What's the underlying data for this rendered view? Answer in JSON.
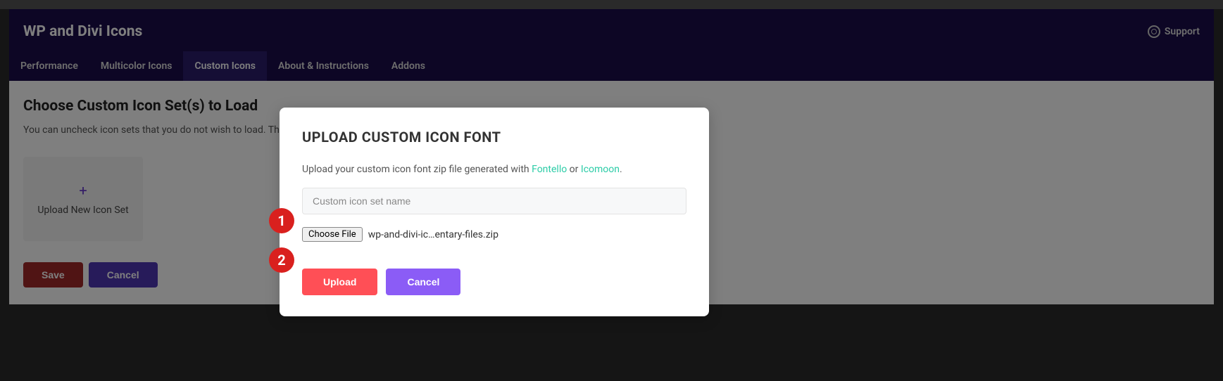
{
  "header": {
    "title": "WP and Divi Icons",
    "support_label": "Support"
  },
  "tabs": [
    {
      "label": "Performance",
      "active": false
    },
    {
      "label": "Multicolor Icons",
      "active": false
    },
    {
      "label": "Custom Icons",
      "active": true
    },
    {
      "label": "About & Instructions",
      "active": false
    },
    {
      "label": "Addons",
      "active": false
    }
  ],
  "page": {
    "section_title": "Choose Custom Icon Set(s) to Load",
    "section_desc": "You can uncheck icon sets that you do not wish to load. This ca",
    "upload_card_label": "Upload New Icon Set",
    "save_label": "Save",
    "cancel_label": "Cancel"
  },
  "modal": {
    "title": "UPLOAD CUSTOM ICON FONT",
    "desc_prefix": "Upload your custom icon font zip file generated with ",
    "link1": "Fontello",
    "desc_mid": " or ",
    "link2": "Icomoon",
    "desc_suffix": ".",
    "name_placeholder": "Custom icon set name",
    "choose_file_label": "Choose File",
    "selected_file": "wp-and-divi-ic…entary-files.zip",
    "upload_label": "Upload",
    "cancel_label": "Cancel"
  },
  "annotations": {
    "badge1": "1",
    "badge2": "2"
  }
}
